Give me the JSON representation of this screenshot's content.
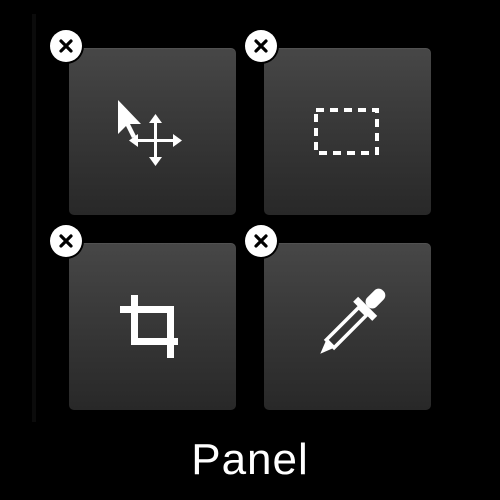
{
  "panel": {
    "label": "Panel",
    "background_color": "#000000",
    "tile_color": "#3d3d3d",
    "badge_color": "#ffffff",
    "icon_color": "#ffffff"
  },
  "tools": [
    {
      "name": "move-tool",
      "icon": "move-tool-icon"
    },
    {
      "name": "rectangular-marquee-tool",
      "icon": "marquee-icon"
    },
    {
      "name": "crop-tool",
      "icon": "crop-icon"
    },
    {
      "name": "eyedropper-tool",
      "icon": "eyedropper-icon"
    }
  ],
  "remove_control": {
    "icon": "close-icon"
  }
}
